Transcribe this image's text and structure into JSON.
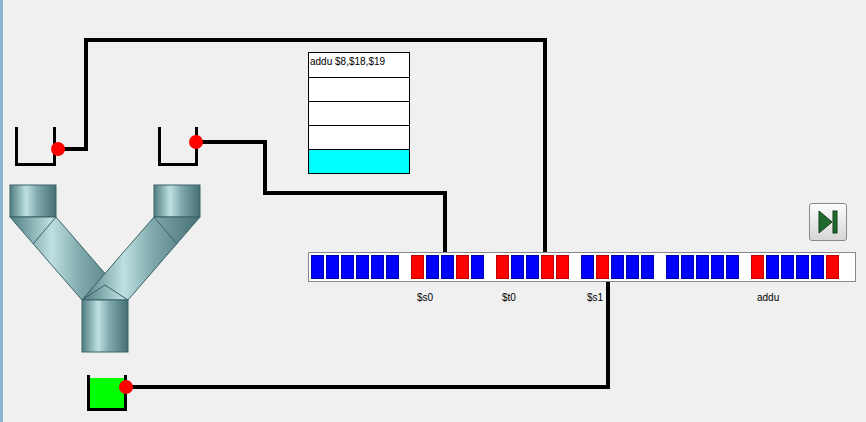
{
  "queue": {
    "rows": [
      {
        "text": "addu $8,$18,$19",
        "selected": false
      },
      {
        "text": "",
        "selected": false
      },
      {
        "text": "",
        "selected": false
      },
      {
        "text": "",
        "selected": false
      },
      {
        "text": "",
        "selected": true
      }
    ]
  },
  "bins": {
    "inputs": [
      {
        "name": "left",
        "level": 0
      },
      {
        "name": "right",
        "level": 0
      }
    ],
    "output": {
      "level": 0.9
    }
  },
  "register_strip": {
    "fields": [
      {
        "bits": [
          0,
          0,
          0,
          0,
          0,
          0
        ]
      },
      {
        "label": "$s0",
        "bits": [
          1,
          0,
          0,
          1,
          0
        ]
      },
      {
        "label": "$t0",
        "bits": [
          1,
          0,
          0,
          1,
          1
        ]
      },
      {
        "label": "$s1",
        "bits": [
          0,
          1,
          0,
          0,
          0
        ]
      },
      {
        "bits": [
          0,
          0,
          0,
          0,
          0
        ]
      },
      {
        "label": "addu",
        "bits": [
          1,
          0,
          0,
          0,
          0,
          1
        ]
      }
    ]
  },
  "step_button": {
    "disabled": false
  }
}
